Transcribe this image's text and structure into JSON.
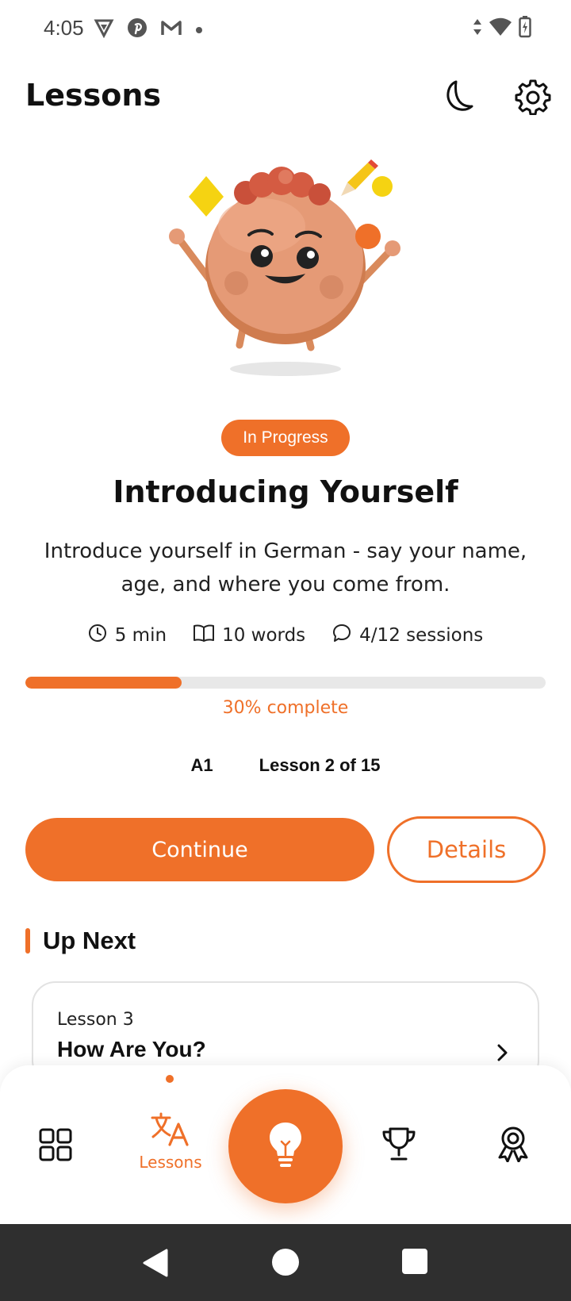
{
  "status": {
    "time": "4:05",
    "icons": [
      "vpn-shield-icon",
      "pinterest-icon",
      "gmail-icon",
      "dot-icon",
      "data-arrows-icon",
      "wifi-icon",
      "battery-charging-icon"
    ]
  },
  "header": {
    "title": "Lessons",
    "icons": [
      "moon-icon",
      "gear-icon"
    ]
  },
  "lesson": {
    "status": "In Progress",
    "title": "Introducing Yourself",
    "description": "Introduce yourself in German - say your name, age, and where you come from.",
    "duration": "5 min",
    "words": "10 words",
    "sessions": "4/12 sessions",
    "progress_fraction": 0.3,
    "progress_label": "30% complete",
    "level": "A1",
    "position": "Lesson 2 of 15"
  },
  "actions": {
    "continue_label": "Continue",
    "details_label": "Details"
  },
  "up_next": {
    "heading": "Up Next",
    "items": [
      {
        "number": "Lesson 3",
        "title": "How Are You?"
      }
    ]
  },
  "bottom_nav": {
    "items": [
      {
        "name": "home",
        "icon": "grid-icon",
        "label": ""
      },
      {
        "name": "lessons",
        "icon": "translate-icon",
        "label": "Lessons",
        "active": true
      },
      {
        "name": "center",
        "icon": "lightbulb-icon",
        "label": ""
      },
      {
        "name": "trophy",
        "icon": "trophy-icon",
        "label": ""
      },
      {
        "name": "awards",
        "icon": "award-ribbon-icon",
        "label": ""
      }
    ]
  },
  "colors": {
    "accent": "#ef7029",
    "track": "#e8e8e8",
    "system_nav": "#2f2f2f"
  }
}
